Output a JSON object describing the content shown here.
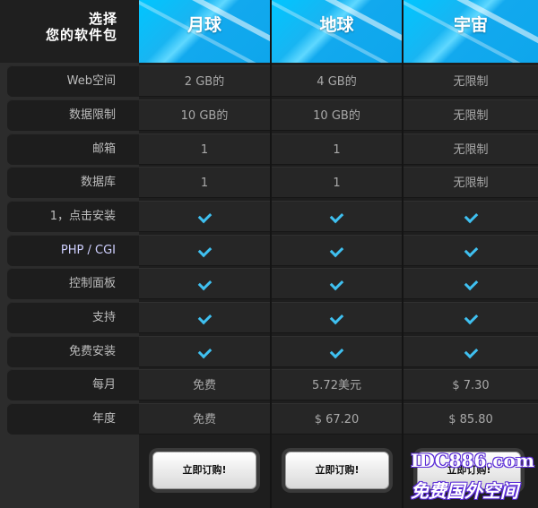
{
  "header": {
    "line1": "选择",
    "line2": "您的软件包"
  },
  "features": [
    "Web空间",
    "数据限制",
    "邮箱",
    "数据库",
    "1，点击安装",
    "PHP / CGI",
    "控制面板",
    "支持",
    "免费安装",
    "每月",
    "年度"
  ],
  "plans": [
    {
      "name": "月球",
      "values": [
        "2 GB的",
        "10 GB的",
        "1",
        "1",
        "check",
        "check",
        "check",
        "check",
        "check",
        "免费",
        "免费"
      ],
      "button": "立即订购!"
    },
    {
      "name": "地球",
      "values": [
        "4 GB的",
        "10 GB的",
        "1",
        "1",
        "check",
        "check",
        "check",
        "check",
        "check",
        "5.72美元",
        "$ 67.20"
      ],
      "button": "立即订购!"
    },
    {
      "name": "宇宙",
      "values": [
        "无限制",
        "无限制",
        "无限制",
        "无限制",
        "check",
        "check",
        "check",
        "check",
        "check",
        "$ 7.30",
        "$ 85.80"
      ],
      "button": "立即订购!"
    }
  ],
  "icons": {
    "check": "checkmark-icon"
  },
  "colors": {
    "accent": "#1ab0f0",
    "check": "#3fc0f0"
  },
  "watermark": {
    "line1": "IDC886.com",
    "line2": "免费国外空间"
  }
}
